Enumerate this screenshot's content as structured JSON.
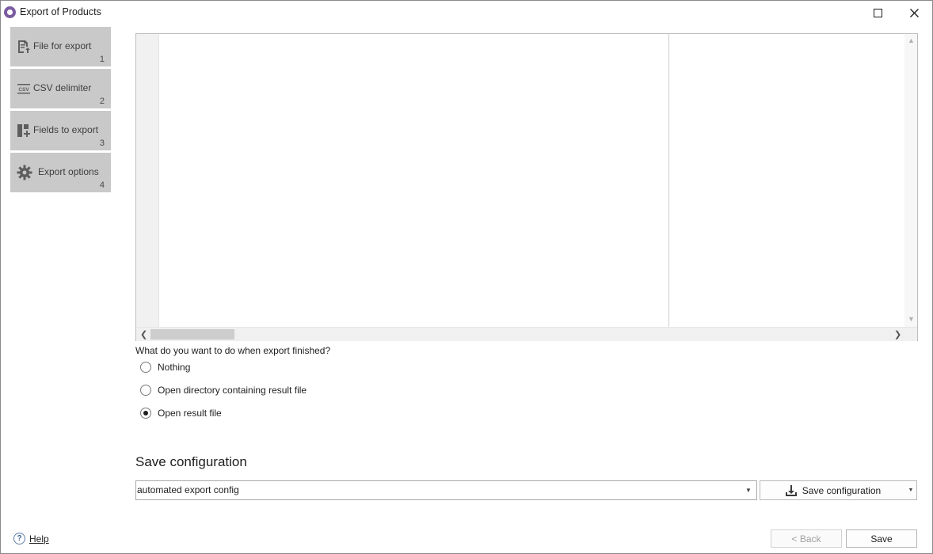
{
  "window": {
    "title": "Export of Products",
    "maximize_icon": "maximize-icon",
    "close_icon": "close-icon"
  },
  "steps": [
    {
      "label": "File for export",
      "number": "1",
      "icon": "file-export-icon"
    },
    {
      "label": "CSV delimiter",
      "number": "2",
      "icon": "csv-icon"
    },
    {
      "label": "Fields to export",
      "number": "3",
      "icon": "fields-icon"
    },
    {
      "label": "Export options",
      "number": "4",
      "icon": "gear-icon"
    }
  ],
  "finish_options": {
    "question": "What do you want to do when export finished?",
    "options": [
      {
        "label": "Nothing",
        "checked": false
      },
      {
        "label": "Open directory containing result file",
        "checked": false
      },
      {
        "label": "Open result file",
        "checked": true
      }
    ]
  },
  "save_config": {
    "title": "Save configuration",
    "value": "automated export config",
    "button_label": "Save configuration",
    "button_icon": "download-icon"
  },
  "footer": {
    "help_label": "Help",
    "back_label": "< Back",
    "save_label": "Save"
  }
}
